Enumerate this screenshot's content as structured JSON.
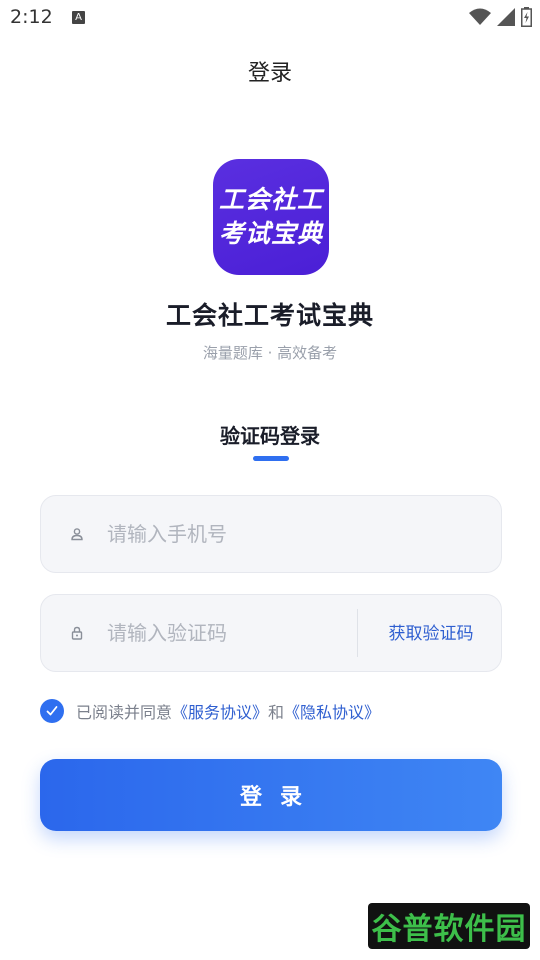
{
  "status_bar": {
    "time": "2:12",
    "notification_glyph": "A"
  },
  "header": {
    "title": "登录"
  },
  "app": {
    "icon_line1": "工会社工",
    "icon_line2": "考试宝典",
    "name": "工会社工考试宝典",
    "slogan": "海量题库 · 高效备考"
  },
  "login_tab": {
    "label": "验证码登录"
  },
  "phone_input": {
    "placeholder": "请输入手机号",
    "value": ""
  },
  "code_input": {
    "placeholder": "请输入验证码",
    "value": "",
    "get_code_label": "获取验证码"
  },
  "agreement": {
    "checked": true,
    "prefix": "已阅读并同意",
    "service_link": "《服务协议》",
    "and": "和",
    "privacy_link": "《隐私协议》"
  },
  "login_button": {
    "label": "登录"
  },
  "watermark": {
    "text": "谷普软件园"
  },
  "colors": {
    "accent": "#2f6ff0",
    "icon_bg": "#5a2fe0",
    "link": "#2f5fd0"
  }
}
